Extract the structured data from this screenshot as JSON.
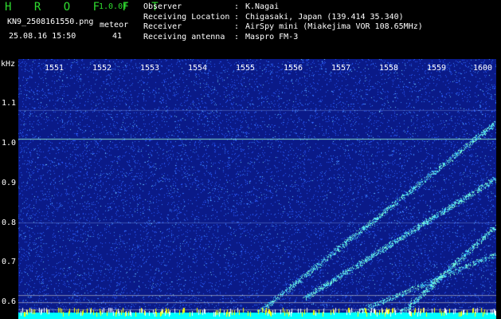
{
  "header": {
    "app_title": "H R O F F T",
    "version": "1.0.0f",
    "filename": "KN9_2508161550.png",
    "datetime": "25.08.16 15:50",
    "meteor_label": "meteor",
    "meteor_count": "41"
  },
  "info": [
    {
      "label": "Observer",
      "value": "K.Nagai"
    },
    {
      "label": "Receiving Location",
      "value": "Chigasaki, Japan (139.414 35.340)"
    },
    {
      "label": "Receiver",
      "value": "AirSpy mini (Miakejima VOR 108.65MHz)"
    },
    {
      "label": "Receiving antenna",
      "value": "Maspro FM-3"
    }
  ],
  "spectrogram": {
    "y_unit": "kHz",
    "y_ticks": [
      "1.1",
      "1.0",
      "0.9",
      "0.8",
      "0.7",
      "0.6"
    ],
    "x_ticks": [
      "1551",
      "1552",
      "1553",
      "1554",
      "1555",
      "1556",
      "1557",
      "1558",
      "1559",
      "1600"
    ],
    "background_color": "#0a1a88",
    "noise_color": "#2a5cff",
    "trace_color": "#7fffd4",
    "bottom_band_color": "#00ffff"
  }
}
